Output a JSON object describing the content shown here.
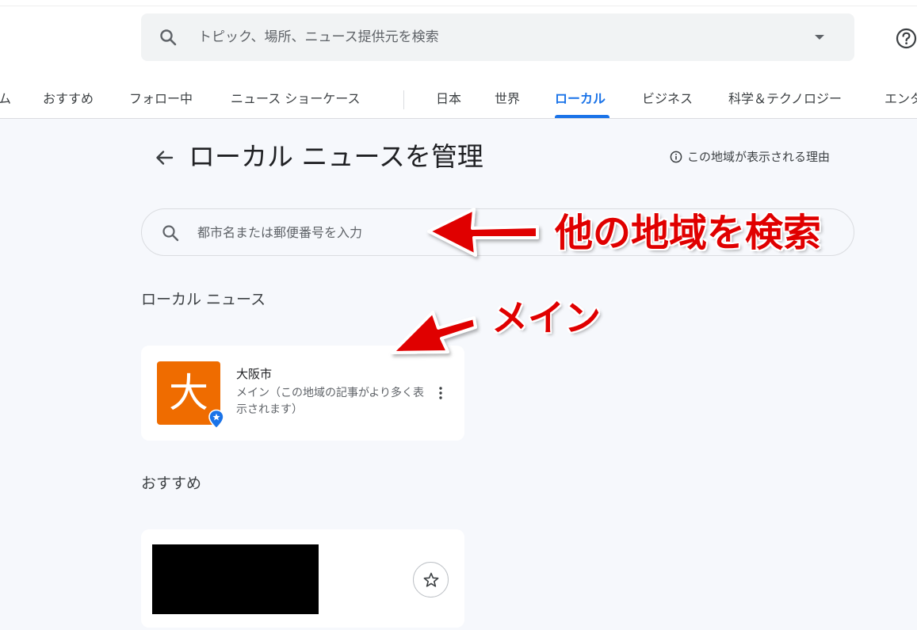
{
  "header": {
    "search_placeholder": "トピック、場所、ニュース提供元を検索"
  },
  "tabs": [
    {
      "label": "ム"
    },
    {
      "label": "おすすめ"
    },
    {
      "label": "フォロー中"
    },
    {
      "label": "ニュース ショーケース"
    },
    {
      "label": "日本"
    },
    {
      "label": "世界"
    },
    {
      "label": "ローカル",
      "active": true
    },
    {
      "label": "ビジネス"
    },
    {
      "label": "科学＆テクノロジー"
    },
    {
      "label": "エンタ"
    }
  ],
  "page": {
    "title": "ローカル ニュースを管理",
    "why_link": "この地域が表示される理由",
    "location_search_placeholder": "都市名または郵便番号を入力"
  },
  "local_news": {
    "section_label": "ローカル ニュース",
    "items": [
      {
        "tile_char": "大",
        "name": "大阪市",
        "description": "メイン（この地域の記事がより多く表示されます）"
      }
    ]
  },
  "recommended": {
    "section_label": "おすすめ"
  },
  "annotations": {
    "search_note": "他の地域を検索",
    "main_note": "メイン"
  },
  "colors": {
    "accent": "#1a73e8",
    "tile": "#ef6c00",
    "annotation": "#e00000"
  },
  "icons": [
    "search-icon",
    "dropdown-caret-icon",
    "help-icon",
    "back-arrow-icon",
    "info-icon",
    "location-pin-icon",
    "more-vert-icon",
    "star-icon"
  ]
}
